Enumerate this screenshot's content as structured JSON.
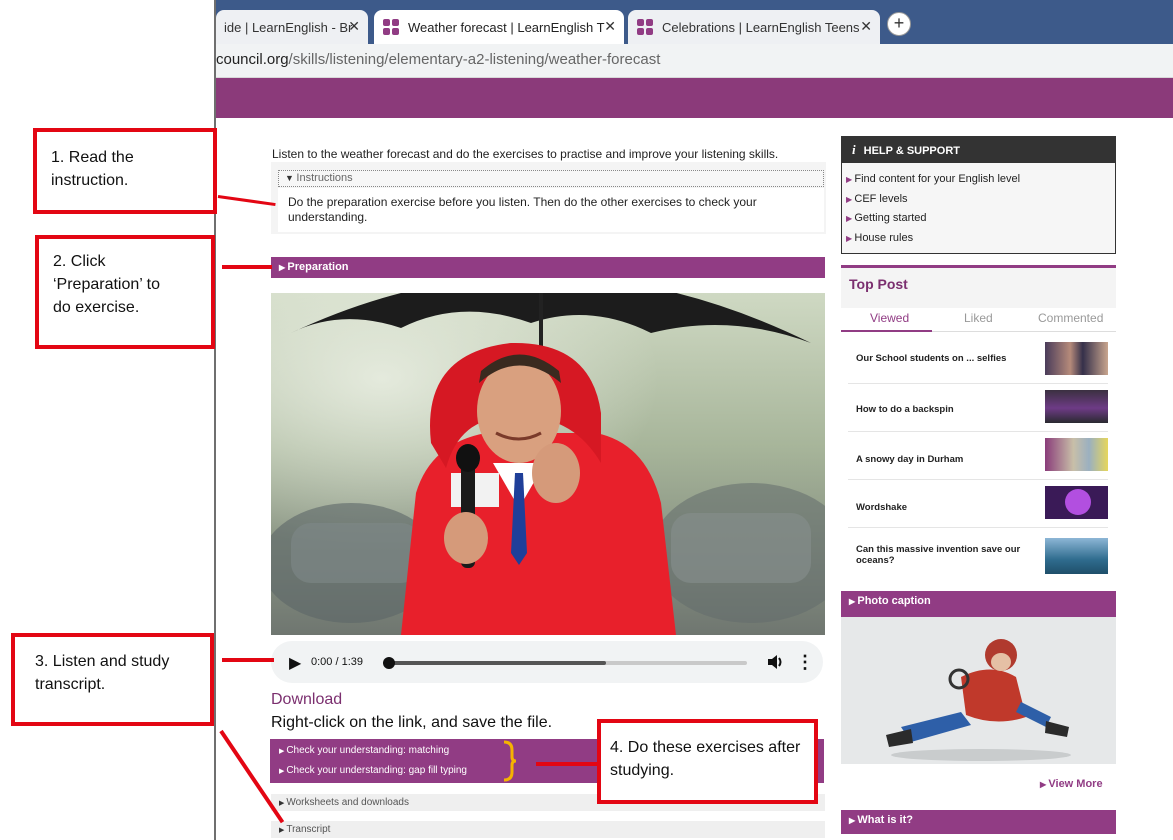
{
  "browser": {
    "tabs": [
      {
        "label": "ide | LearnEnglish - Br",
        "active": false
      },
      {
        "label": "Weather forecast | LearnEnglish T",
        "active": true
      },
      {
        "label": "Celebrations | LearnEnglish Teens",
        "active": false
      }
    ],
    "close_glyph": "✕",
    "new_tab_glyph": "+",
    "url_domain": "council.org",
    "url_path": "/skills/listening/elementary-a2-listening/weather-forecast"
  },
  "main": {
    "intro": "Listen to the weather forecast and do the exercises to practise and improve your listening skills.",
    "instructions_label": "Instructions",
    "instructions_text": "Do the preparation exercise before you listen. Then do the other exercises to check your understanding.",
    "preparation_label": "Preparation",
    "audio": {
      "time": "0:00 / 1:39",
      "progress": 0.0,
      "buffered": 0.61
    },
    "download_title": "Download",
    "download_text": "Right-click on the link, and save the file.",
    "exercises": [
      "Check your understanding: matching",
      "Check your understanding: gap fill typing"
    ],
    "worksheets_label": "Worksheets and downloads",
    "transcript_label": "Transcript"
  },
  "sidebar": {
    "help_title": "HELP & SUPPORT",
    "help_links": [
      "Find content for your English level",
      "CEF levels",
      "Getting started",
      "House rules"
    ],
    "top_post_title": "Top Post",
    "top_post_tabs": [
      "Viewed",
      "Liked",
      "Commented"
    ],
    "posts": [
      "Our School students on ... selfies",
      "How to do a backspin",
      "A snowy day in Durham",
      "Wordshake",
      "Can this massive invention save our oceans?"
    ],
    "photo_caption_label": "Photo caption",
    "view_more": "View More",
    "what_is_it": "What is it?"
  },
  "annotations": {
    "step1": "1. Read the instruction.",
    "step2": "2. Click ‘Preparation’ to do exercise.",
    "step3": "3. Listen and study transcript.",
    "step4": "4. Do these exercises after studying."
  },
  "colors": {
    "site_purple": "#913c84",
    "annotation_red": "#e30613",
    "tab_strip": "#3d5a8a"
  }
}
